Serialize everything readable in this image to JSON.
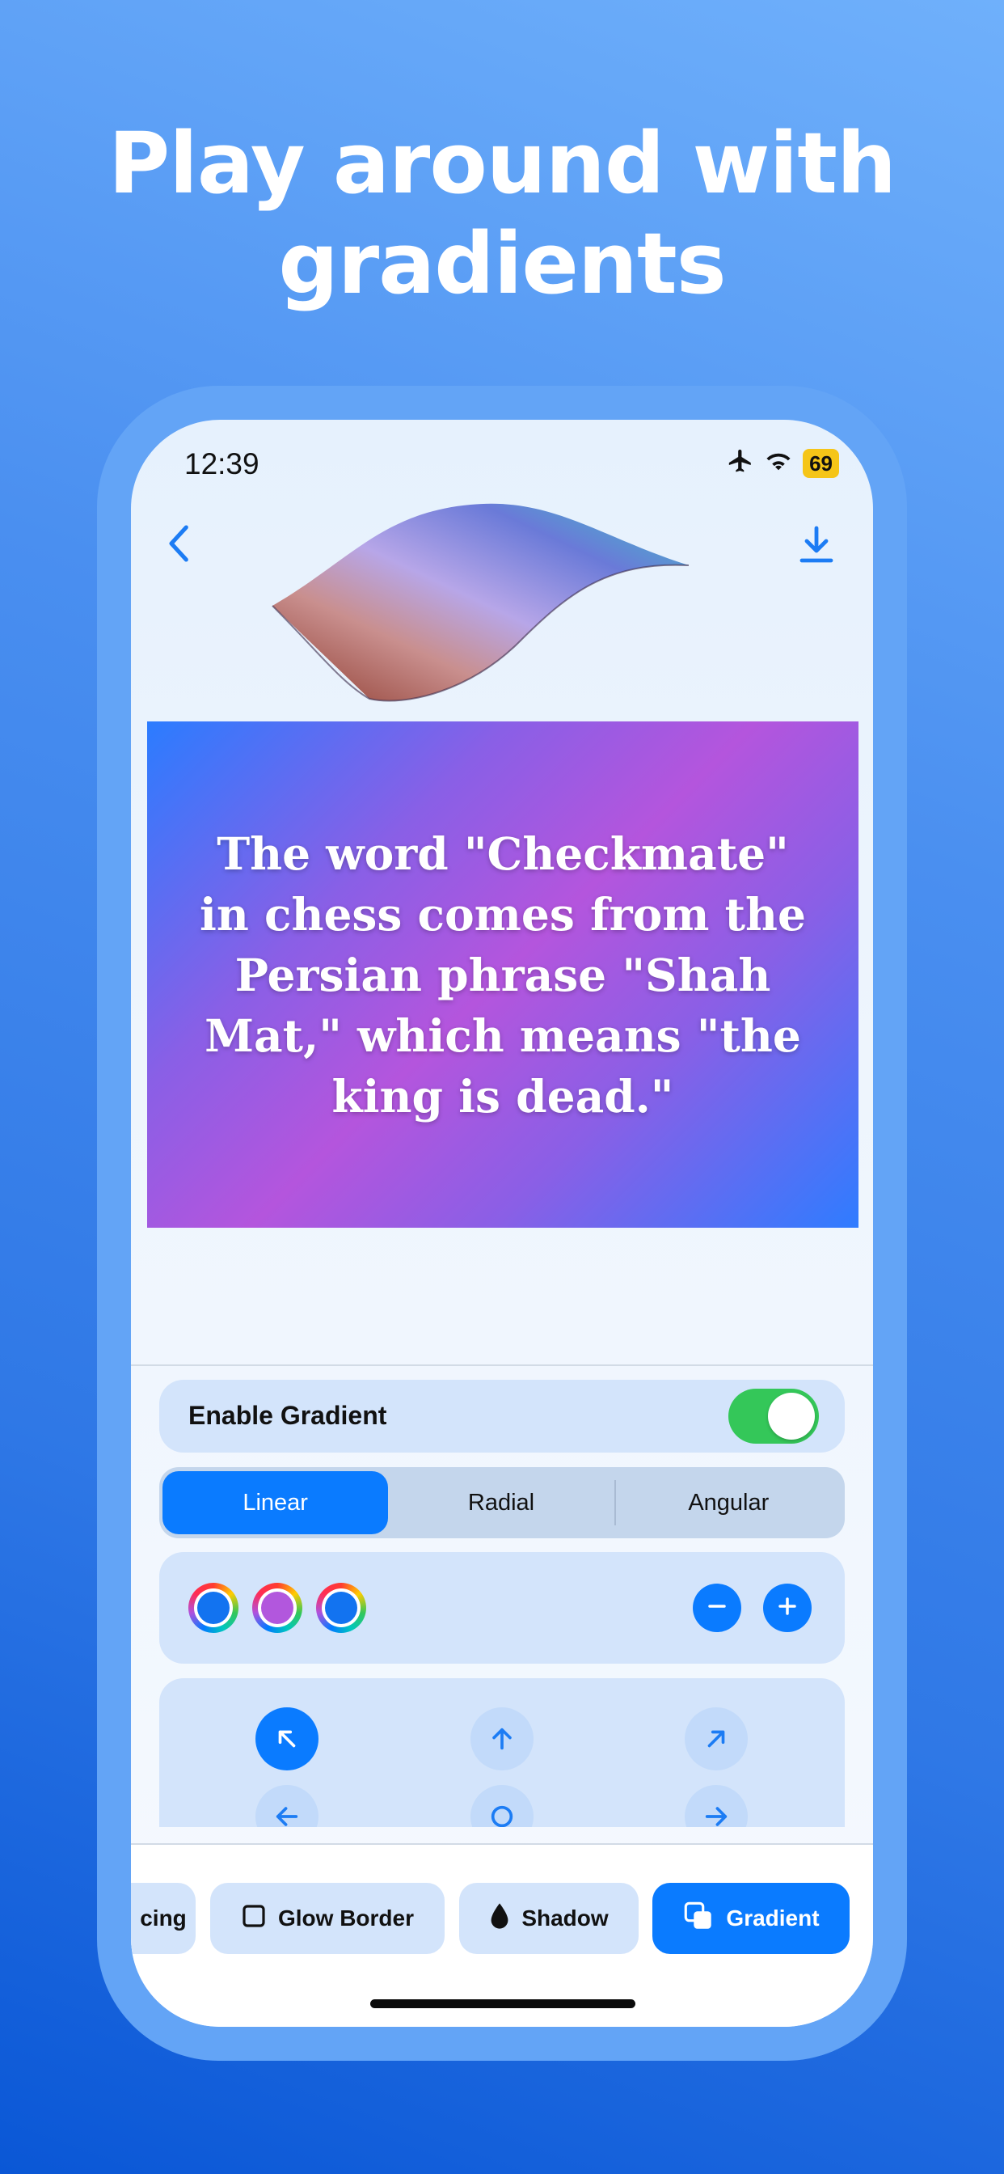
{
  "headline": {
    "line1": "Play around with",
    "line2": "gradients"
  },
  "status_bar": {
    "time": "12:39",
    "battery": "69"
  },
  "quote": "The word \"Checkmate\" in chess comes from the Persian phrase \"Shah Mat,\" which means \"the king is dead.\"",
  "enable_gradient": {
    "label": "Enable Gradient",
    "on": true
  },
  "gradient_type": {
    "options": [
      "Linear",
      "Radial",
      "Angular"
    ],
    "selected": "Linear"
  },
  "colors": [
    "#1273f0",
    "#b257dd",
    "#1273f0"
  ],
  "direction": {
    "selected": "top-left",
    "arrows": [
      "arrow-up-left-icon",
      "arrow-up-icon",
      "arrow-up-right-icon",
      "arrow-left-icon",
      "center-circle-icon",
      "arrow-right-icon"
    ]
  },
  "tabs": {
    "partial": "cing",
    "glow_border": "Glow Border",
    "shadow": "Shadow",
    "gradient": "Gradient",
    "selected": "Gradient"
  },
  "accent": "#0a7bff"
}
